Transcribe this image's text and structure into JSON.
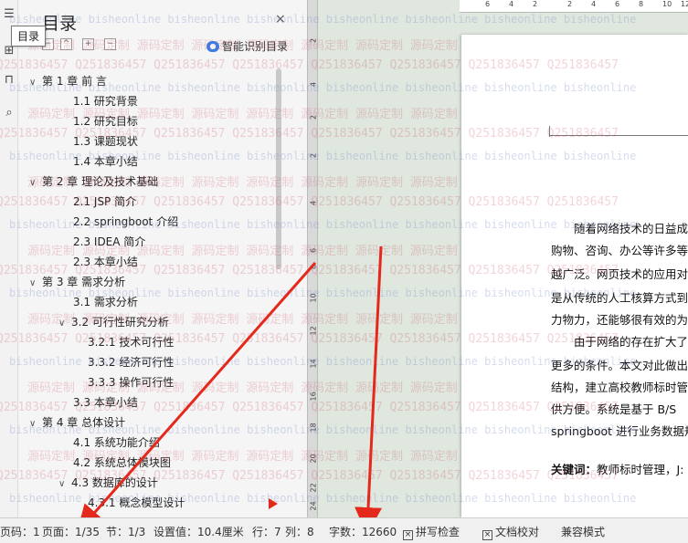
{
  "rail": {
    "tooltip": "目录"
  },
  "toc": {
    "title": "目录",
    "close": "×",
    "smart_label": "智能识别目录",
    "items": [
      {
        "text": "第 1 章  前  言",
        "level": 1,
        "chevron": "v"
      },
      {
        "text": "1.1  研究背景",
        "level": 2
      },
      {
        "text": "1.2  研究目标",
        "level": 2
      },
      {
        "text": "1.3  课题现状",
        "level": 2
      },
      {
        "text": "1.4 本章小结",
        "level": 2
      },
      {
        "text": "第 2 章  理论及技术基础",
        "level": 1,
        "chevron": "v"
      },
      {
        "text": "2.1 JSP 简介",
        "level": 2
      },
      {
        "text": "2.2 springboot 介绍",
        "level": 2
      },
      {
        "text": "2.3   IDEA 简介",
        "level": 2
      },
      {
        "text": "2.3  本章小结",
        "level": 2
      },
      {
        "text": "第 3 章  需求分析",
        "level": 1,
        "chevron": "v"
      },
      {
        "text": "3.1  需求分析",
        "level": 2
      },
      {
        "text": "3.2  可行性研究分析",
        "level": 2,
        "chevron": "v"
      },
      {
        "text": "3.2.1  技术可行性",
        "level": 3
      },
      {
        "text": "3.3.2  经济可行性",
        "level": 3
      },
      {
        "text": "3.3.3  操作可行性",
        "level": 3
      },
      {
        "text": "3.3  本章小结",
        "level": 2
      },
      {
        "text": "第 4 章  总体设计",
        "level": 1,
        "chevron": "v"
      },
      {
        "text": "4.1  系统功能介绍",
        "level": 2
      },
      {
        "text": "4.2  系统总体模块图",
        "level": 2
      },
      {
        "text": "4.3  数据库的设计",
        "level": 2,
        "chevron": "v"
      },
      {
        "text": "4.3.1  概念模型设计",
        "level": 3
      }
    ]
  },
  "ruler": {
    "vertical": [
      "2",
      "4",
      "2",
      "2",
      "4",
      "6",
      "8",
      "10",
      "12",
      "14",
      "16",
      "18",
      "20",
      "22",
      "24"
    ],
    "horizontal": [
      "6",
      "4",
      "2",
      "2",
      "4",
      "6",
      "8",
      "10",
      "12"
    ]
  },
  "document": {
    "lines": [
      "　　随着网络技术的日益成",
      "购物、咨询、办公等许多等",
      "越广泛。网页技术的应用对",
      "是从传统的人工核算方式到",
      "力物力，还能够很有效的为",
      "　　由于网络的存在扩大了",
      "更多的条件。本文对此做出",
      "结构，建立高校教师标时管",
      "供方便。系统是基于 B/S",
      "springboot 进行业务数据规"
    ],
    "keywords_label": "关键词：",
    "keywords_text": "教师标时管理，J:"
  },
  "watermark": {
    "site": "bisheonline",
    "brand": "源码定制",
    "qq": "Q2518364​57"
  },
  "status": {
    "page_num": "页码：1",
    "pages": "页面：1/35",
    "section": "节：1/3",
    "setting": "设置值：10.4厘米",
    "row": "行：7",
    "col": "列：8",
    "words": "字数：12660",
    "spell": "拼写检查",
    "proof": "文档校对",
    "compat": "兼容模式"
  },
  "colors": {
    "annotation_arrow": "#e5281c",
    "canvas_bg": "#dfe7df"
  }
}
